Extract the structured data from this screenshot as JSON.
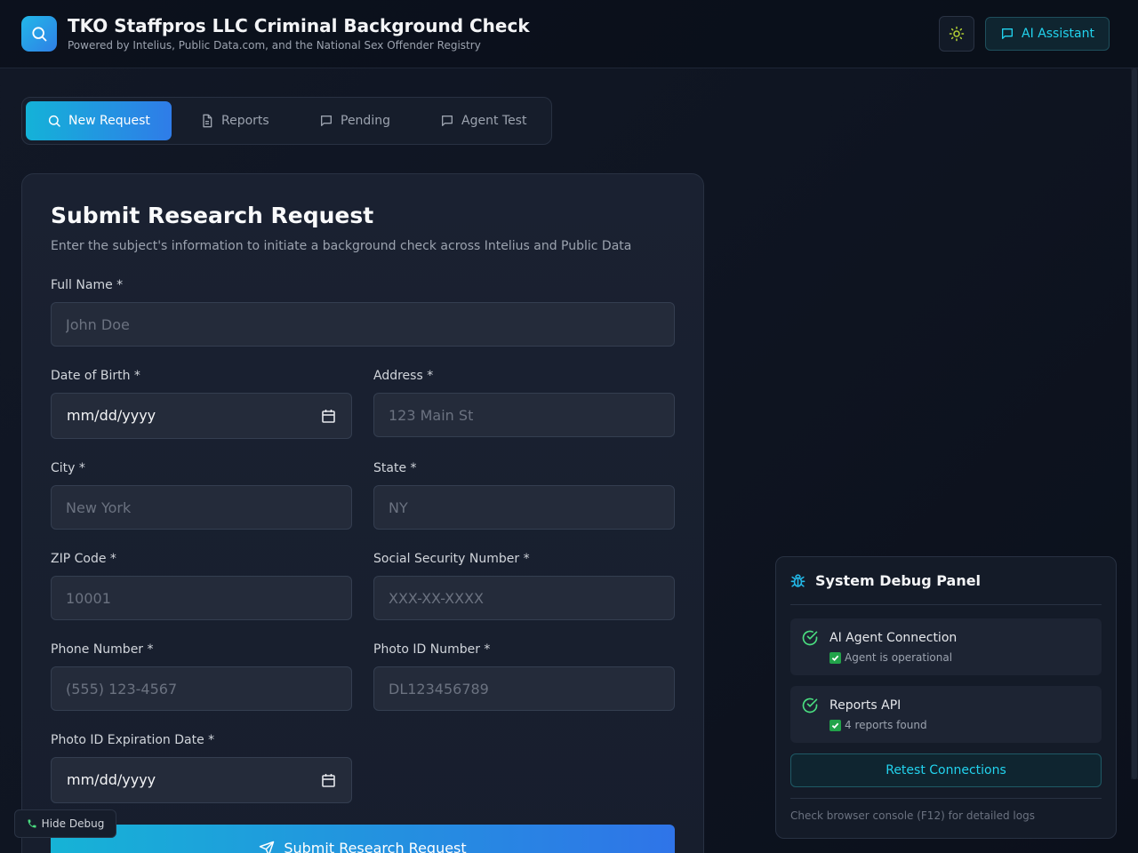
{
  "header": {
    "title": "TKO Staffpros LLC Criminal Background Check",
    "subtitle": "Powered by Intelius, Public Data.com, and the National Sex Offender Registry",
    "logo_icon": "search-icon",
    "theme_icon": "sun-icon",
    "ai_button_label": "AI Assistant"
  },
  "tabs": [
    {
      "label": "New Request",
      "icon": "search-icon",
      "active": true
    },
    {
      "label": "Reports",
      "icon": "document-icon",
      "active": false
    },
    {
      "label": "Pending",
      "icon": "message-icon",
      "active": false
    },
    {
      "label": "Agent Test",
      "icon": "message-icon",
      "active": false
    }
  ],
  "form": {
    "title": "Submit Research Request",
    "description": "Enter the subject's information to initiate a background check across Intelius and Public Data",
    "fields": {
      "full_name": {
        "label": "Full Name *",
        "placeholder": "John Doe",
        "value": ""
      },
      "dob": {
        "label": "Date of Birth *",
        "value": "mm/dd/yyyy"
      },
      "address": {
        "label": "Address *",
        "placeholder": "123 Main St",
        "value": ""
      },
      "city": {
        "label": "City *",
        "placeholder": "New York",
        "value": ""
      },
      "state": {
        "label": "State *",
        "placeholder": "NY",
        "value": ""
      },
      "zip": {
        "label": "ZIP Code *",
        "placeholder": "10001",
        "value": ""
      },
      "ssn": {
        "label": "Social Security Number *",
        "placeholder": "XXX-XX-XXXX",
        "value": ""
      },
      "phone": {
        "label": "Phone Number *",
        "placeholder": "(555) 123-4567",
        "value": ""
      },
      "photo_id": {
        "label": "Photo ID Number *",
        "placeholder": "DL123456789",
        "value": ""
      },
      "photo_id_exp": {
        "label": "Photo ID Expiration Date *",
        "value": "mm/dd/yyyy"
      }
    },
    "submit_label": "Submit Research Request"
  },
  "debug": {
    "title": "System Debug Panel",
    "title_icon": "bug-icon",
    "checks": [
      {
        "name": "AI Agent Connection",
        "message": "Agent is operational",
        "status": "ok"
      },
      {
        "name": "Reports API",
        "message": "4 reports found",
        "status": "ok"
      }
    ],
    "retest_label": "Retest Connections",
    "footer": "Check browser console (F12) for detailed logs",
    "hide_label": "Hide Debug"
  },
  "colors": {
    "accent": "#22d3ee",
    "primary_gradient_start": "#14b2d8",
    "primary_gradient_end": "#2f7ce8",
    "success": "#22c55e",
    "background": "#0f1522"
  }
}
